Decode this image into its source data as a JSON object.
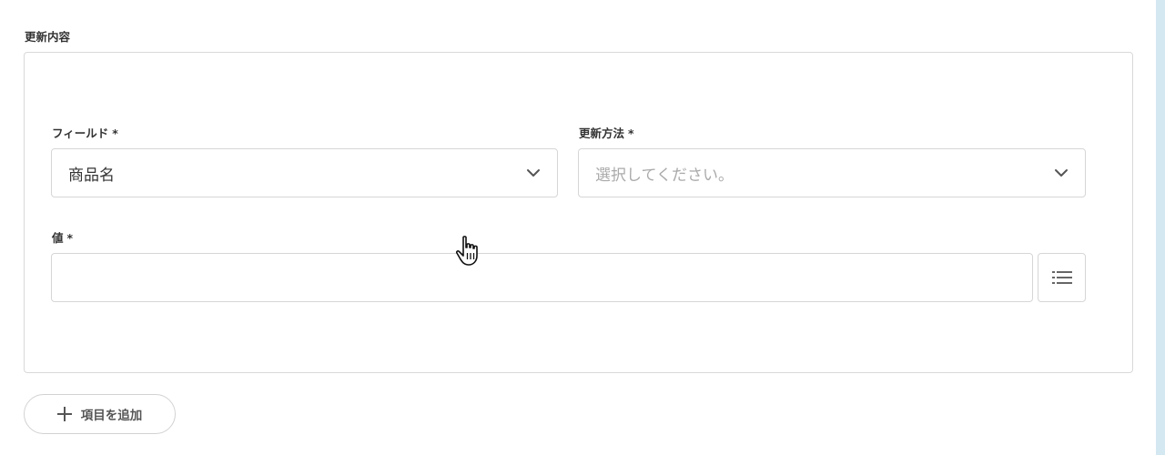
{
  "section": {
    "title": "更新内容"
  },
  "fields": {
    "field": {
      "label": "フィールド",
      "required_mark": "*",
      "value": "商品名"
    },
    "method": {
      "label": "更新方法",
      "required_mark": "*",
      "placeholder": "選択してください。"
    },
    "value": {
      "label": "値",
      "required_mark": "*",
      "input_value": ""
    }
  },
  "actions": {
    "add_item_label": "項目を追加"
  },
  "icons": {
    "chevron": "chevron-down-icon",
    "list": "list-icon",
    "plus": "plus-icon",
    "cursor": "hand-pointer-cursor-icon"
  },
  "colors": {
    "border": "#d6d6d6",
    "placeholder": "#aaaaaa",
    "text": "#333333",
    "scrollbar": "#d4e8f2"
  }
}
